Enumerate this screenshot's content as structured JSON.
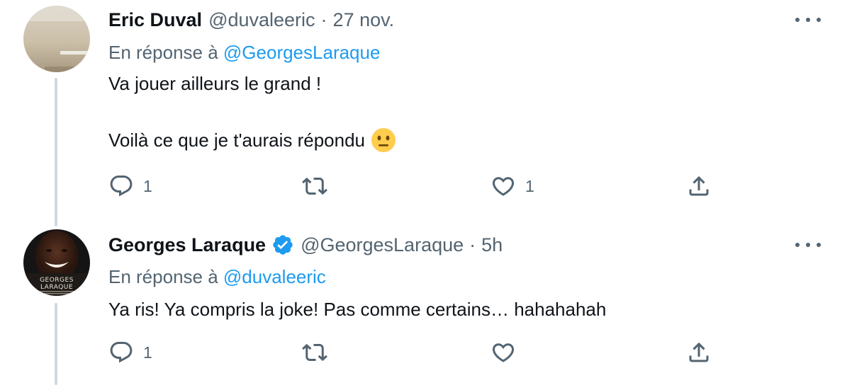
{
  "colors": {
    "accent": "#1d9bf0",
    "text_primary": "#0f1419",
    "text_secondary": "#536471",
    "thread_line": "#cfd9de"
  },
  "tweets": [
    {
      "display_name": "Eric Duval",
      "handle": "@duvaleeric",
      "separator": "·",
      "time": "27 nov.",
      "reply_prefix": "En réponse à",
      "reply_to": "@GeorgesLaraque",
      "lines": [
        "Va jouer ailleurs le grand !",
        "Voilà ce que je t'aurais répondu"
      ],
      "emoji": "neutral-face",
      "reply_count": "1",
      "like_count": "1",
      "avatar": "blurred-indoor-photo"
    },
    {
      "display_name": "Georges Laraque",
      "verified": true,
      "handle": "@GeorgesLaraque",
      "separator": "·",
      "time": "5h",
      "reply_prefix": "En réponse à",
      "reply_to": "@duvaleeric",
      "lines": [
        "Ya ris! Ya compris la joke! Pas comme certains… hahahahah"
      ],
      "reply_count": "1",
      "avatar": "book-cover-photo",
      "avatar_text": [
        "GEORGES",
        "LARAQUE"
      ]
    }
  ]
}
